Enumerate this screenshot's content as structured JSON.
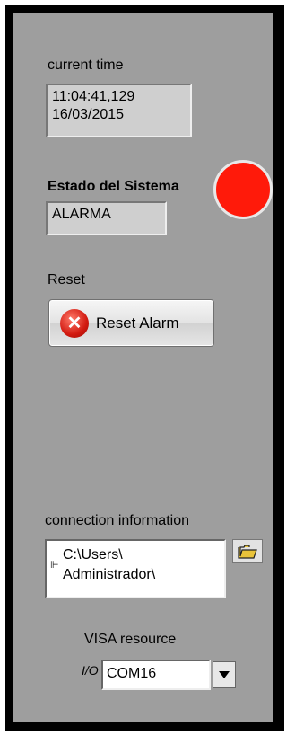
{
  "current_time": {
    "label": "current time",
    "time": "11:04:41,129",
    "date": "16/03/2015"
  },
  "system_status": {
    "label": "Estado del Sistema",
    "value": "ALARMA",
    "led_color": "#ff1a0a"
  },
  "reset": {
    "label": "Reset",
    "button_label": "Reset Alarm",
    "button_icon": "error-x-icon"
  },
  "connection": {
    "label": "connection information",
    "path_line1": "C:\\Users\\",
    "path_line2": "Administrador\\",
    "browse_icon": "folder-open-icon"
  },
  "visa": {
    "label": "VISA resource",
    "value": "COM16",
    "icon": "visa-io-icon"
  }
}
